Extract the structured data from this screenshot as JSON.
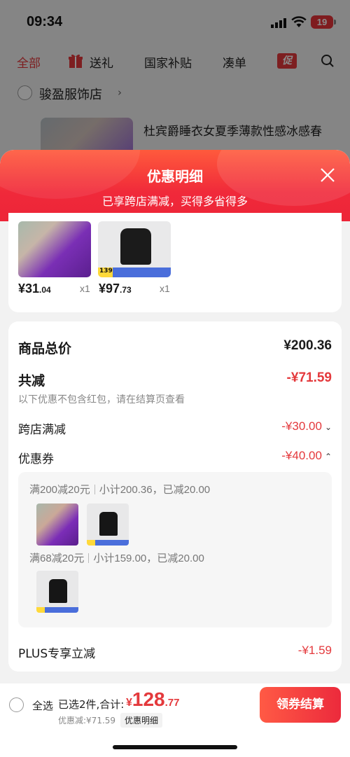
{
  "status_bar": {
    "time": "09:34",
    "battery": "19"
  },
  "tabs": {
    "all": "全部",
    "gift": "送礼",
    "subsidy": "国家补贴",
    "bundle": "凑单",
    "promo": "促"
  },
  "store": {
    "name": "骏盈服饰店",
    "chevron": "›",
    "product_title": "杜宾爵睡衣女夏季薄款性感冰感春"
  },
  "sheet": {
    "title": "优惠明细",
    "subtitle": "已享跨店满减，买得多省得多"
  },
  "products": [
    {
      "price_int": "¥31",
      "price_dec": ".04",
      "qty": "x1"
    },
    {
      "price_int": "¥97",
      "price_dec": ".73",
      "qty": "x1",
      "tag": "139"
    }
  ],
  "summary": {
    "total_label": "商品总价",
    "total_value": "¥200.36",
    "reduce_label": "共减",
    "reduce_value": "-¥71.59",
    "note": "以下优惠不包含红包，请在结算页查看",
    "cross_store_label": "跨店满减",
    "cross_store_value": "-¥30.00",
    "coupon_label": "优惠券",
    "coupon_value": "-¥40.00",
    "plus_label": "PLUS专享立减",
    "plus_value": "-¥1.59"
  },
  "coupon_rules": [
    {
      "rule": "满200减20元",
      "detail": "小计200.36，已减20.00"
    },
    {
      "rule": "满68减20元",
      "detail": "小计159.00，已减20.00"
    }
  ],
  "bottom_bar": {
    "select_all": "全选",
    "selected": "已选2件,合计:",
    "currency": "¥",
    "total_int": "128",
    "total_dec": ".77",
    "discount": "优惠减:¥71.59",
    "detail_link": "优惠明细",
    "checkout": "领券结算"
  },
  "colors": {
    "accent": "#e4393c",
    "header_gradient_start": "#ff5a3c",
    "header_gradient_end": "#ed2538"
  }
}
